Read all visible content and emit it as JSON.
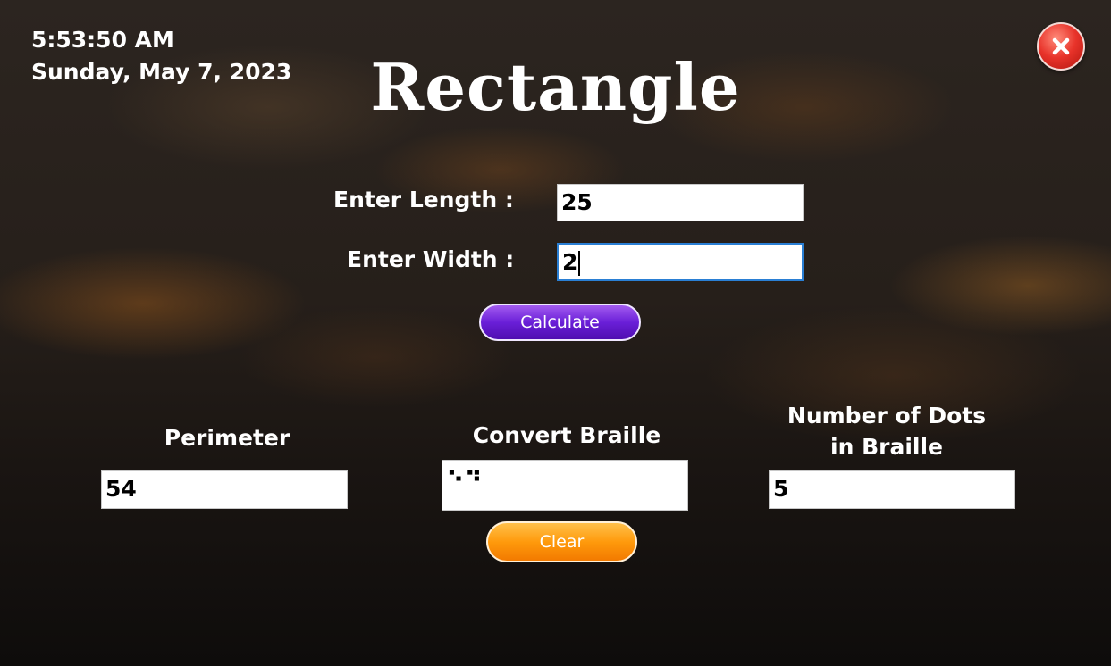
{
  "clock": {
    "time": "5:53:50 AM",
    "date": "Sunday, May 7, 2023"
  },
  "title": "Rectangle",
  "close": {
    "icon": "close-icon",
    "color": "#e8332a"
  },
  "inputs": {
    "length_label": "Enter Length :",
    "length_value": "25",
    "width_label": "Enter Width :",
    "width_value": "2"
  },
  "buttons": {
    "calculate": "Calculate",
    "clear": "Clear"
  },
  "results": {
    "perimeter_label": "Perimeter",
    "perimeter_value": "54",
    "braille_label": "Convert Braille",
    "braille_value": "⠑⠙",
    "dots_label_line1": "Number of Dots",
    "dots_label_line2": "in Braille",
    "dots_value": "5"
  },
  "colors": {
    "calculate_button": "#6a1fd8",
    "clear_button": "#ff9a0c"
  }
}
